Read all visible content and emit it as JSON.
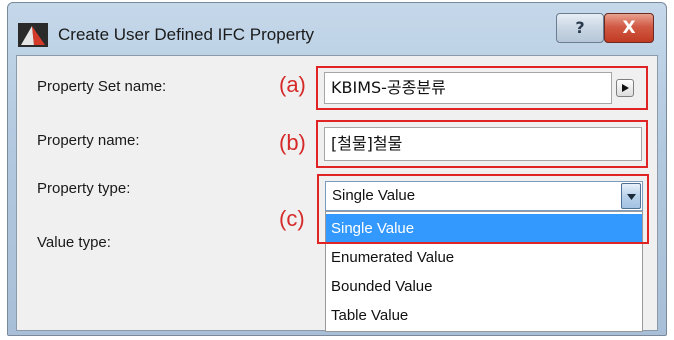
{
  "window": {
    "title": "Create User Defined IFC Property",
    "help_label": "?",
    "close_label": "X"
  },
  "form": {
    "property_set_label": "Property Set name:",
    "property_set_value": "KBIMS-공종분류",
    "property_name_label": "Property name:",
    "property_name_value": "[철물]철물",
    "property_type_label": "Property type:",
    "property_type_value": "Single Value",
    "value_type_label": "Value type:"
  },
  "annotations": {
    "a": "(a)",
    "b": "(b)",
    "c": "(c)"
  },
  "dropdown": {
    "options": [
      "Single Value",
      "Enumerated Value",
      "Bounded Value",
      "Table Value"
    ],
    "selected": "Single Value"
  },
  "colors": {
    "annotation_red": "#e02424",
    "highlight_blue": "#3399ff"
  }
}
